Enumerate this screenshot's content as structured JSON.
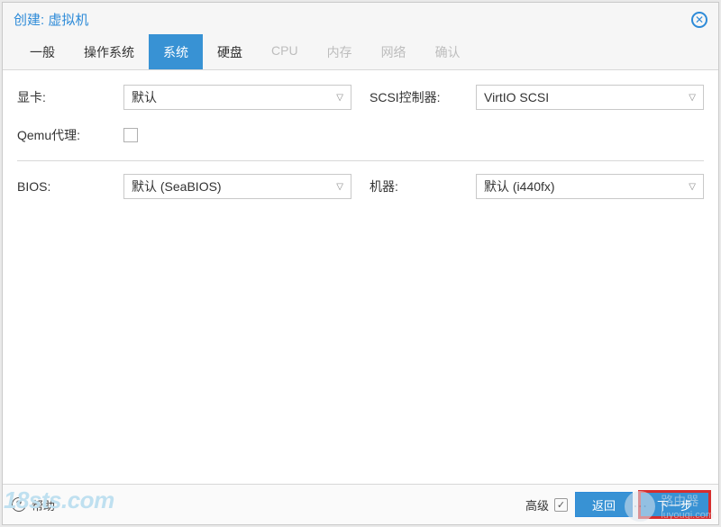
{
  "dialog": {
    "title": "创建: 虚拟机"
  },
  "tabs": {
    "general": "一般",
    "os": "操作系统",
    "system": "系统",
    "disk": "硬盘",
    "cpu": "CPU",
    "memory": "内存",
    "network": "网络",
    "confirm": "确认",
    "active_index": 2
  },
  "fields": {
    "gpu_label": "显卡:",
    "gpu_value": "默认",
    "scsi_label": "SCSI控制器:",
    "scsi_value": "VirtIO SCSI",
    "qemu_agent_label": "Qemu代理:",
    "qemu_agent_checked": false,
    "bios_label": "BIOS:",
    "bios_value": "默认 (SeaBIOS)",
    "machine_label": "机器:",
    "machine_value": "默认 (i440fx)"
  },
  "footer": {
    "help": "帮助",
    "advanced": "高级",
    "advanced_checked": true,
    "back": "返回",
    "next": "下一步"
  },
  "watermarks": {
    "left": "18sts.com",
    "right_label": "路由器",
    "right_sub": "luyouqi.com"
  }
}
